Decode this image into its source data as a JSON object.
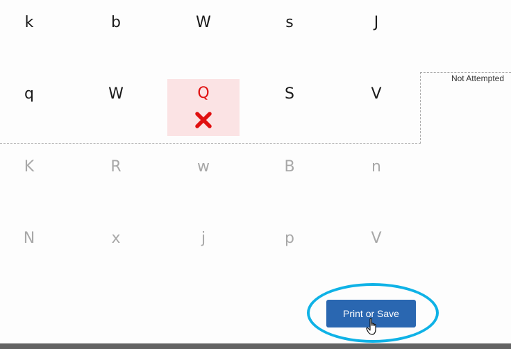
{
  "grid": {
    "rows": [
      {
        "letters": [
          "k",
          "b",
          "W",
          "s",
          "J"
        ],
        "state": "attempted"
      },
      {
        "letters": [
          "q",
          "W",
          "Q",
          "S",
          "V"
        ],
        "state": "attempted"
      },
      {
        "letters": [
          "K",
          "R",
          "w",
          "B",
          "n"
        ],
        "state": "not-attempted"
      },
      {
        "letters": [
          "N",
          "x",
          "j",
          "p",
          "V"
        ],
        "state": "not-attempted"
      }
    ],
    "incorrect_cell": {
      "row": 1,
      "col": 2,
      "letter": "Q"
    }
  },
  "legend": {
    "not_attempted_label": "Not Attempted"
  },
  "actions": {
    "print_save_label": "Print or Save"
  },
  "colors": {
    "incorrect": "#e01010",
    "incorrect_bg": "#fbe3e4",
    "button": "#2a67b1",
    "highlight": "#0fb2e6"
  }
}
